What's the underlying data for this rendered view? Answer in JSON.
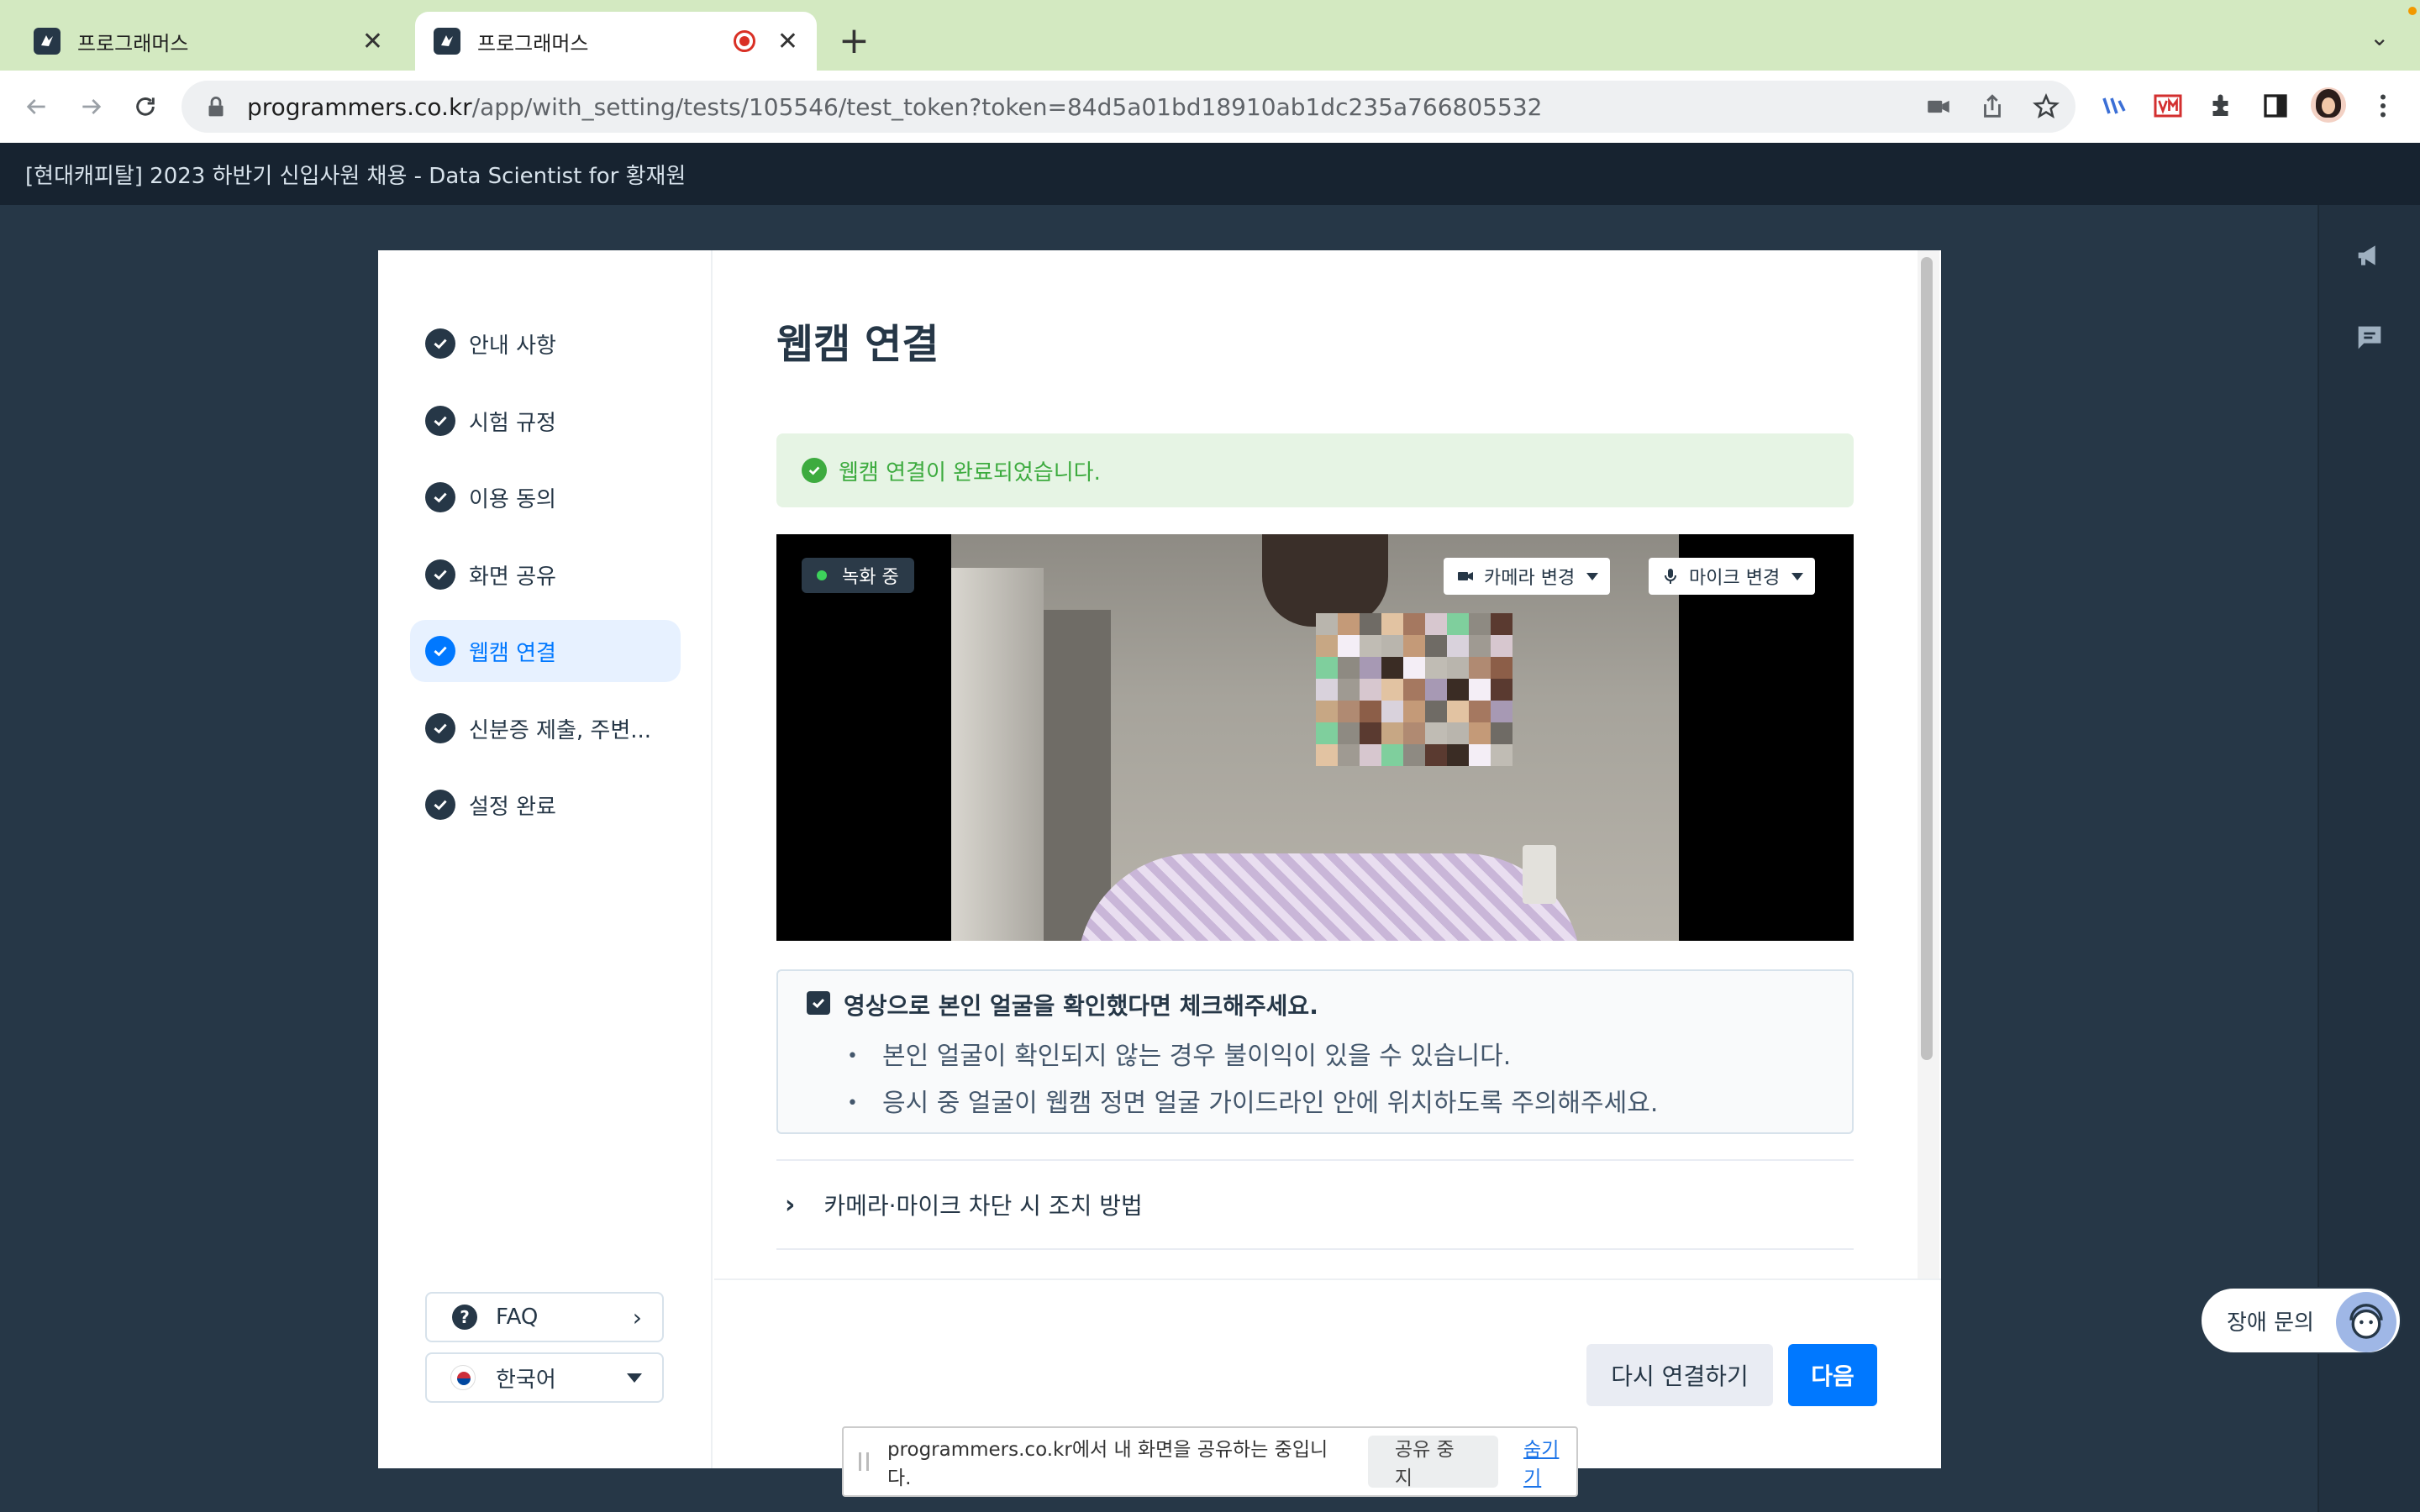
{
  "browser": {
    "tabs": [
      {
        "title": "프로그래머스",
        "active": false
      },
      {
        "title": "프로그래머스",
        "active": true,
        "recording": true
      }
    ],
    "new_tab": "+",
    "url_host": "programmers.co.kr",
    "url_path": "/app/with_setting/tests/105546/test_token?token=84d5a01bd18910ab1dc235a766805532"
  },
  "header": {
    "title": "[현대캐피탈] 2023 하반기 신입사원 채용 - Data Scientist for 황재원"
  },
  "sidebar": {
    "steps": [
      {
        "label": "안내 사항",
        "done": true
      },
      {
        "label": "시험 규정",
        "done": true
      },
      {
        "label": "이용 동의",
        "done": true
      },
      {
        "label": "화면 공유",
        "done": true
      },
      {
        "label": "웹캠 연결",
        "done": true,
        "active": true
      },
      {
        "label": "신분증 제출, 주변...",
        "done": true
      },
      {
        "label": "설정 완료",
        "done": true
      }
    ],
    "faq_label": "FAQ",
    "language": "한국어"
  },
  "main": {
    "title": "웹캠 연결",
    "success_message": "웹캠 연결이 완료되었습니다.",
    "video": {
      "recording_label": "녹화 중",
      "camera_button": "카메라 변경",
      "mic_button": "마이크 변경"
    },
    "confirm": {
      "checked": true,
      "heading": "영상으로 본인 얼굴을 확인했다면 체크해주세요.",
      "bullets": [
        "본인 얼굴이 확인되지 않는 경우 불이익이 있을 수 있습니다.",
        "응시 중 얼굴이 웹캠 정면 얼굴 가이드라인 안에 위치하도록 주의해주세요."
      ]
    },
    "accordion_label": "카메라·마이크 차단 시 조치 방법",
    "retry_button": "다시 연결하기",
    "next_button": "다음"
  },
  "share_bar": {
    "message": "programmers.co.kr에서 내 화면을 공유하는 중입니다.",
    "stop_button": "공유 중지",
    "hide_link": "숨기기"
  },
  "help": {
    "label": "장애 문의"
  },
  "colors": {
    "accent": "#0078ff",
    "navy": "#263747",
    "success": "#3dab3f",
    "page_bg": "#263747"
  }
}
